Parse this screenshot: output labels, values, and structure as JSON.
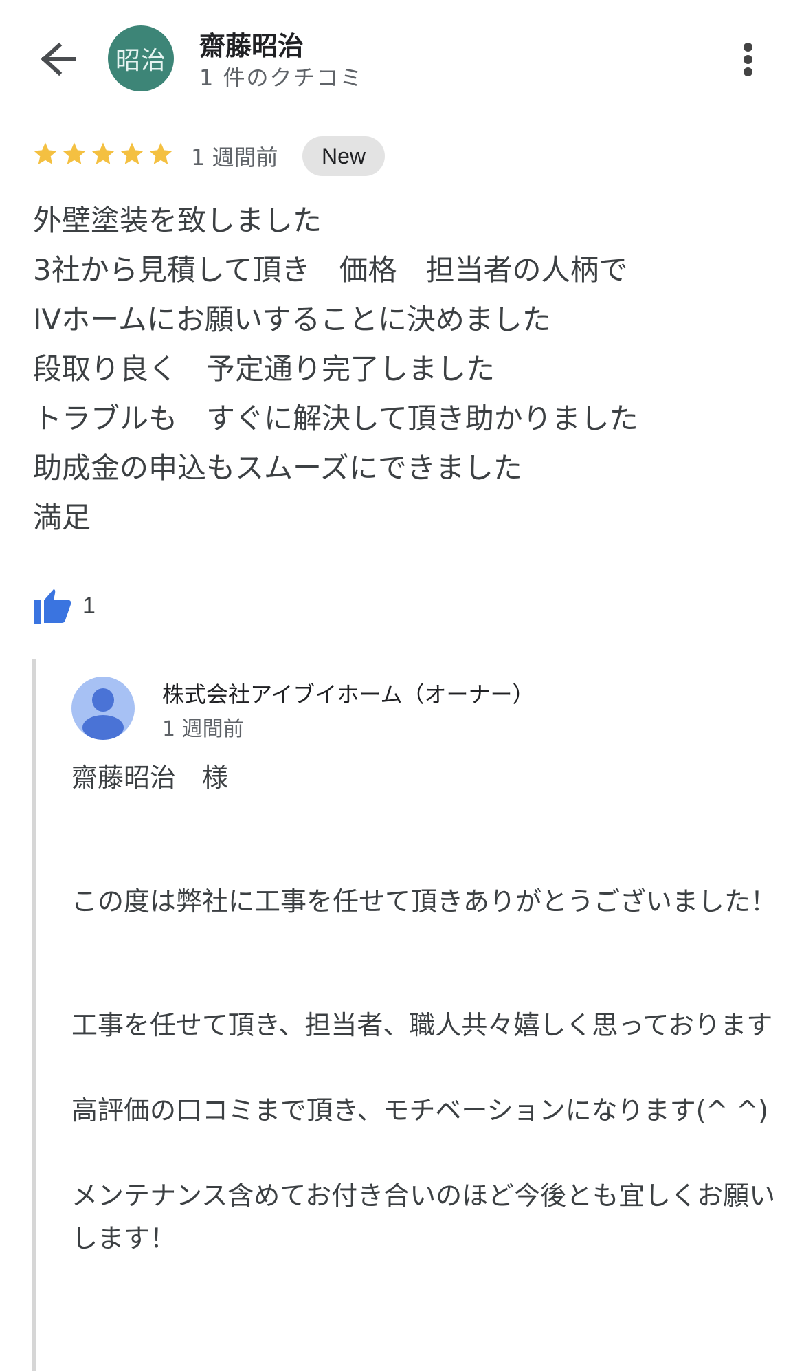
{
  "header": {
    "back_icon": "arrow-left-icon",
    "avatar_text": "昭治",
    "reviewer_name": "齋藤昭治",
    "review_count": "1 件のクチコミ",
    "more_icon": "more-vert-icon"
  },
  "review": {
    "rating": 5,
    "rating_max": 5,
    "time": "1 週間前",
    "badge": "New",
    "lines": [
      "外壁塗装を致しました",
      "3社から見積して頂き　価格　担当者の人柄で",
      "IVホームにお願いすることに決めました",
      "段取り良く　予定通り完了しました",
      "トラブルも　すぐに解決して頂き助かりました",
      "助成金の申込もスムーズにできました",
      "満足"
    ],
    "like_count": "1",
    "colors": {
      "star": "#f4c041",
      "like": "#3a74e0",
      "avatar": "#3d8577"
    }
  },
  "owner_reply": {
    "name": "株式会社アイブイホーム（オーナー）",
    "time": "1 週間前",
    "greeting": "齋藤昭治　様",
    "paragraph1": "この度は弊社に工事を任せて頂きありがとうございました！",
    "paragraph2": "工事を任せて頂き、担当者、職人共々嬉しく思っております",
    "paragraph3": "高評価の口コミまで頂き、モチベーションになります(^ ^)",
    "paragraph4": "メンテナンス含めてお付き合いのほど今後とも宜しくお願いします！"
  }
}
